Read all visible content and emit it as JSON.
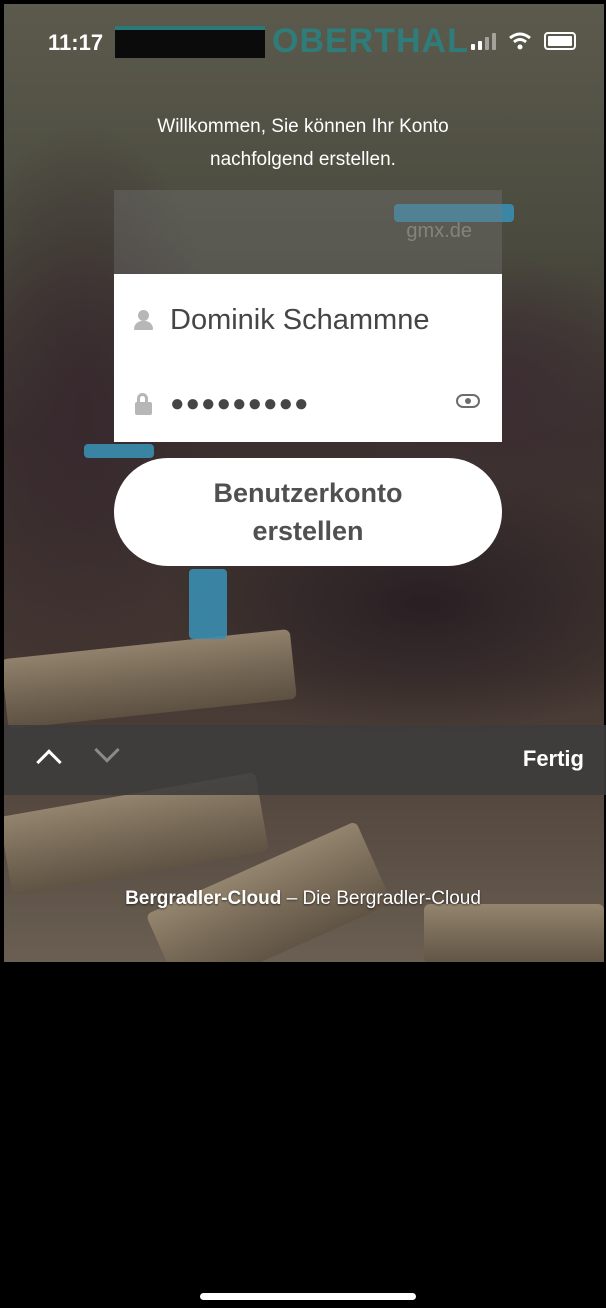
{
  "status_bar": {
    "time": "11:17"
  },
  "header": {
    "logo_text": "OBERTHAL"
  },
  "welcome": {
    "line1": "Willkommen, Sie können Ihr Konto",
    "line2": "nachfolgend erstellen."
  },
  "form": {
    "email_ghost": "gmx.de",
    "username_value": "Dominik Schammne",
    "password_value": "●●●●●●●●●",
    "submit_label_line1": "Benutzerkonto",
    "submit_label_line2": "erstellen"
  },
  "keyboard_toolbar": {
    "done_label": "Fertig"
  },
  "footer": {
    "brand": "Bergradler-Cloud",
    "separator": " – ",
    "tagline": "Die Bergradler-Cloud"
  },
  "colors": {
    "logo": "#2e7d7a",
    "card": "#ffffff",
    "toolbar": "#3c3c3c",
    "bottom": "#000000"
  },
  "icons": [
    "location-arrow-icon",
    "signal-icon",
    "wifi-icon",
    "battery-icon",
    "user-icon",
    "lock-icon",
    "eye-icon",
    "chevron-up-icon",
    "chevron-down-icon"
  ]
}
